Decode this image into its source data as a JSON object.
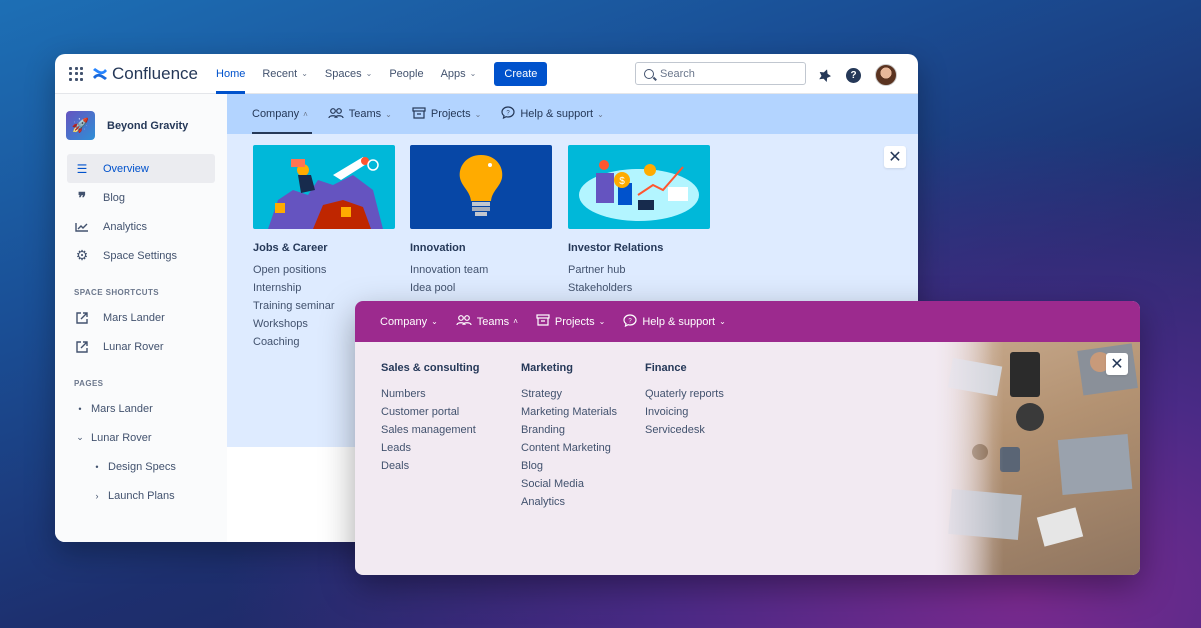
{
  "topbar": {
    "app_name": "Confluence",
    "nav": [
      {
        "label": "Home",
        "dropdown": false,
        "active": true
      },
      {
        "label": "Recent",
        "dropdown": true
      },
      {
        "label": "Spaces",
        "dropdown": true
      },
      {
        "label": "People",
        "dropdown": false
      },
      {
        "label": "Apps",
        "dropdown": true
      }
    ],
    "create_label": "Create",
    "search_placeholder": "Search"
  },
  "sidebar": {
    "space_name": "Beyond Gravity",
    "items": [
      {
        "label": "Overview",
        "icon": "overview-icon"
      },
      {
        "label": "Blog",
        "icon": "quote-icon"
      },
      {
        "label": "Analytics",
        "icon": "chart-icon"
      },
      {
        "label": "Space Settings",
        "icon": "gear-icon"
      }
    ],
    "shortcuts_heading": "SPACE SHORTCUTS",
    "shortcuts": [
      "Mars Lander",
      "Lunar Rover"
    ],
    "pages_heading": "PAGES",
    "pages": [
      {
        "label": "Mars Lander"
      },
      {
        "label": "Lunar Rover"
      },
      {
        "label": "Design Specs"
      },
      {
        "label": "Launch Plans"
      }
    ]
  },
  "mega1": {
    "tabs": [
      "Company",
      "Teams",
      "Projects",
      "Help & support"
    ],
    "columns": [
      {
        "title": "Jobs & Career",
        "links": [
          "Open positions",
          "Internship",
          "Training seminar",
          "Workshops",
          "Coaching"
        ]
      },
      {
        "title": "Innovation",
        "links": [
          "Innovation team",
          "Idea pool"
        ]
      },
      {
        "title": "Investor Relations",
        "links": [
          "Partner hub",
          "Stakeholders"
        ]
      }
    ]
  },
  "mega2": {
    "tabs": [
      "Company",
      "Teams",
      "Projects",
      "Help & support"
    ],
    "columns": [
      {
        "title": "Sales & consulting",
        "links": [
          "Numbers",
          "Customer portal",
          "Sales management",
          "Leads",
          "Deals"
        ]
      },
      {
        "title": "Marketing",
        "links": [
          "Strategy",
          "Marketing Materials",
          "Branding",
          "Content Marketing",
          "Blog",
          "Social Media",
          "Analytics"
        ]
      },
      {
        "title": "Finance",
        "links": [
          "Quaterly reports",
          "Invoicing",
          "Servicedesk"
        ]
      }
    ]
  },
  "colors": {
    "brand": "#0052cc",
    "purple_bar": "#9c2a8e",
    "mega_bg": "#deebff"
  }
}
